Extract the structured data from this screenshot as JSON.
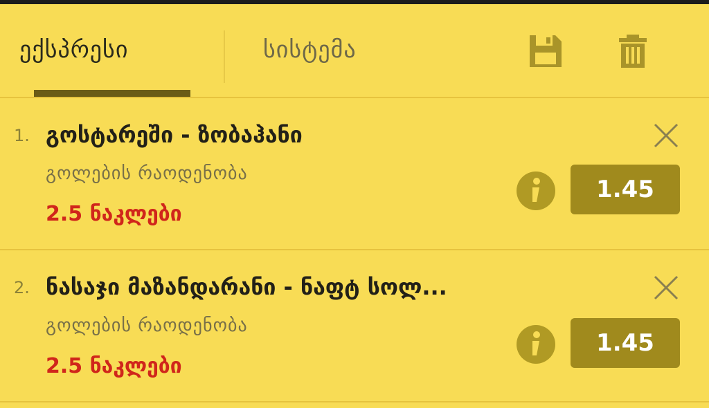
{
  "tabs": {
    "express": "ექსპრესი",
    "system": "სისტემა"
  },
  "header_icons": {
    "save": "save-icon",
    "trash": "trash-icon"
  },
  "bets": [
    {
      "number": "1.",
      "match": "გოსტარეში - ზობაჰანი",
      "market": "გოლების რაოდენობა",
      "pick": "2.5 ნაკლები",
      "odds": "1.45"
    },
    {
      "number": "2.",
      "match": "ნასაჯი მაზანდარანი - ნაფტ სოლ...",
      "market": "გოლების რაოდენობა",
      "pick": "2.5 ნაკლები",
      "odds": "1.45"
    }
  ],
  "colors": {
    "background": "#f8dc55",
    "odds_button": "#a08a1d",
    "pick_text": "#d0261b",
    "tab_underline": "#6b5c16"
  }
}
